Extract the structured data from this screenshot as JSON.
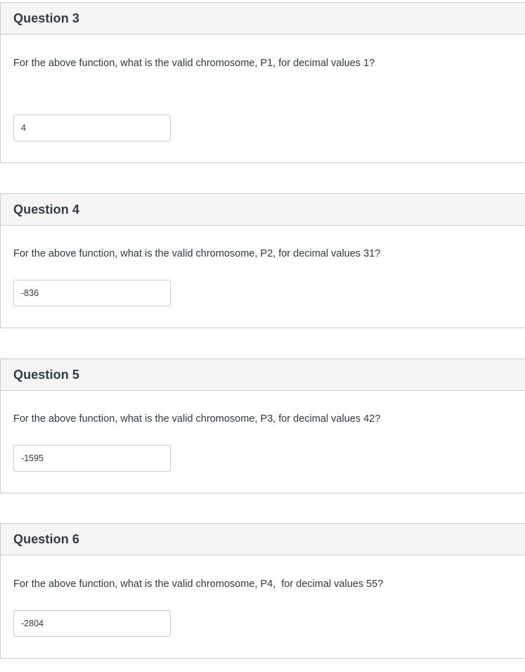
{
  "questions": [
    {
      "title": "Question 3",
      "text": "For the above function, what is the valid chromosome, P1, for decimal values 1?",
      "answer": "4"
    },
    {
      "title": "Question 4",
      "text": "For the above function, what is the valid chromosome, P2, for decimal values 31?",
      "answer": "-836"
    },
    {
      "title": "Question 5",
      "text": "For the above function, what is the valid chromosome, P3, for decimal values 42?",
      "answer": "-1595"
    },
    {
      "title": "Question 6",
      "text": "For the above function, what is the valid chromosome, P4,  for decimal values 55?",
      "answer": "-2804"
    }
  ]
}
